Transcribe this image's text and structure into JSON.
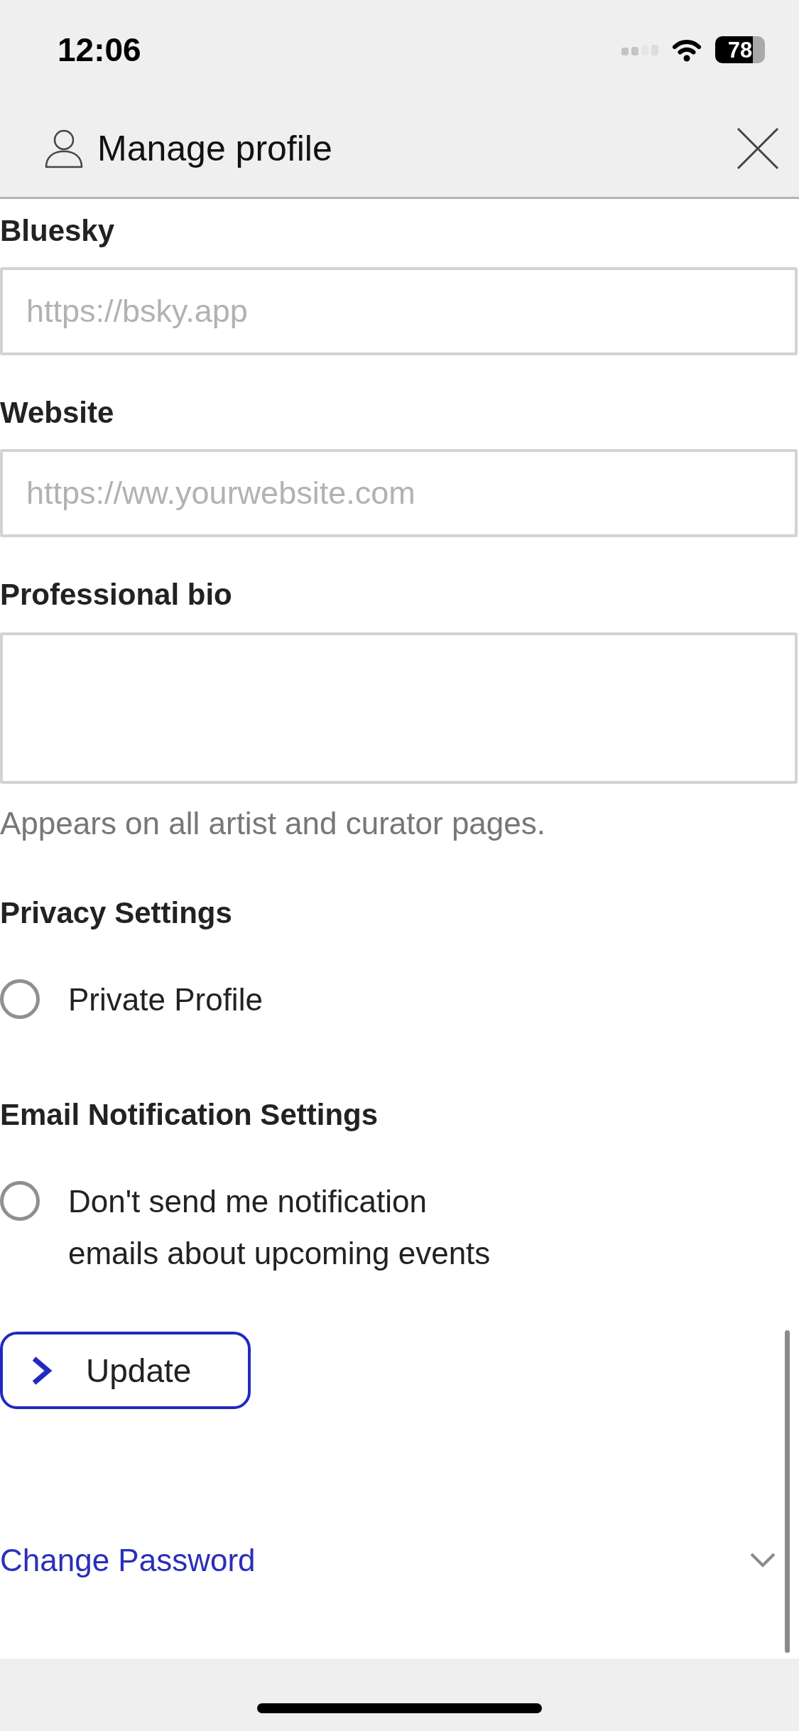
{
  "status_bar": {
    "time": "12:06",
    "battery": "78"
  },
  "header": {
    "title": "Manage profile"
  },
  "fields": [
    {
      "kind": "input",
      "label": "Bluesky",
      "placeholder": "https://bsky.app"
    },
    {
      "kind": "input",
      "label": "Website",
      "placeholder": "https://ww.yourwebsite.com"
    },
    {
      "kind": "textarea",
      "label": "Professional bio",
      "hint": "Appears on all artist and curator pages."
    }
  ],
  "sections": [
    {
      "heading": "Privacy Settings",
      "options": [
        {
          "label": "Private Profile",
          "checked": false
        }
      ]
    },
    {
      "heading": "Email Notification Settings",
      "options": [
        {
          "label": "Don't send me notification emails about upcoming events",
          "checked": false
        }
      ]
    }
  ],
  "update_button": {
    "label": "Update"
  },
  "change_password": {
    "label": "Change Password",
    "expanded": false
  }
}
